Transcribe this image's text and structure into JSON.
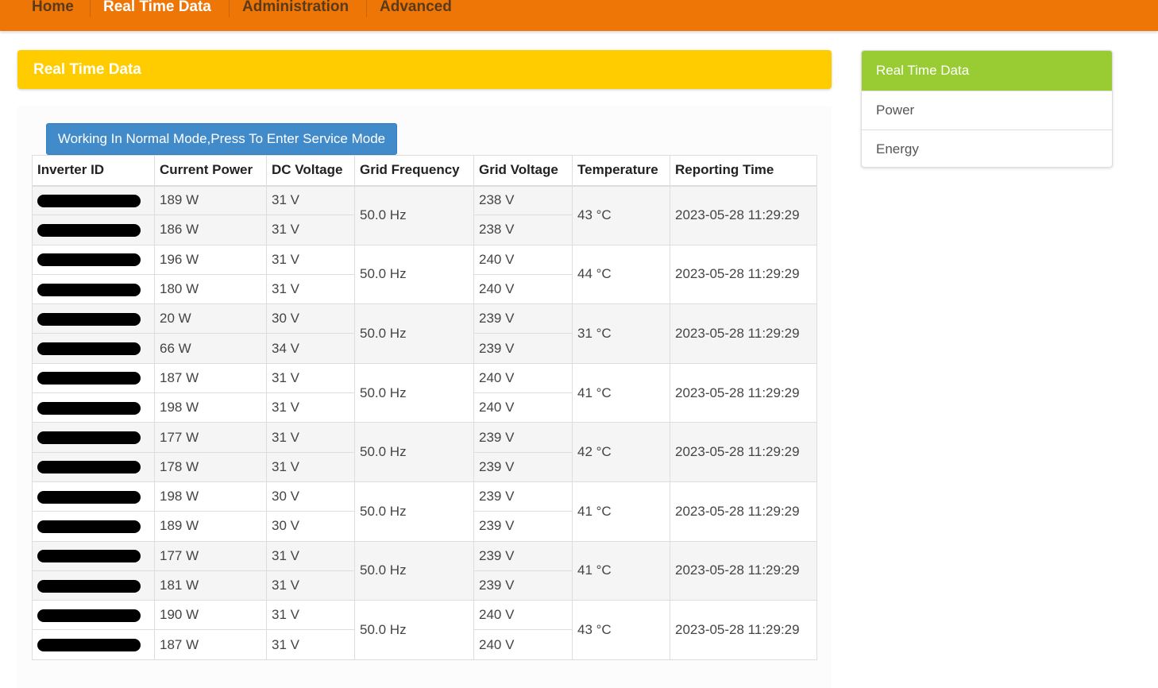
{
  "nav": {
    "items": [
      {
        "label": "Home",
        "active": false
      },
      {
        "label": "Real Time Data",
        "active": true
      },
      {
        "label": "Administration",
        "active": false
      },
      {
        "label": "Advanced",
        "active": false
      }
    ]
  },
  "page": {
    "title": "Real Time Data"
  },
  "mode_button": {
    "label": "Working In Normal Mode,Press To Enter Service Mode"
  },
  "table": {
    "headers": [
      "Inverter ID",
      "Current Power",
      "DC Voltage",
      "Grid Frequency",
      "Grid Voltage",
      "Temperature",
      "Reporting Time"
    ],
    "groups": [
      {
        "frequency": "50.0 Hz",
        "temperature": "43 °C",
        "time": "2023-05-28 11:29:29",
        "rows": [
          {
            "power": "189 W",
            "dc": "31 V",
            "grid": "238 V"
          },
          {
            "power": "186 W",
            "dc": "31 V",
            "grid": "238 V"
          }
        ]
      },
      {
        "frequency": "50.0 Hz",
        "temperature": "44 °C",
        "time": "2023-05-28 11:29:29",
        "rows": [
          {
            "power": "196 W",
            "dc": "31 V",
            "grid": "240 V"
          },
          {
            "power": "180 W",
            "dc": "31 V",
            "grid": "240 V"
          }
        ]
      },
      {
        "frequency": "50.0 Hz",
        "temperature": "31 °C",
        "time": "2023-05-28 11:29:29",
        "rows": [
          {
            "power": "20 W",
            "dc": "30 V",
            "grid": "239 V"
          },
          {
            "power": "66 W",
            "dc": "34 V",
            "grid": "239 V"
          }
        ]
      },
      {
        "frequency": "50.0 Hz",
        "temperature": "41 °C",
        "time": "2023-05-28 11:29:29",
        "rows": [
          {
            "power": "187 W",
            "dc": "31 V",
            "grid": "240 V"
          },
          {
            "power": "198 W",
            "dc": "31 V",
            "grid": "240 V"
          }
        ]
      },
      {
        "frequency": "50.0 Hz",
        "temperature": "42 °C",
        "time": "2023-05-28 11:29:29",
        "rows": [
          {
            "power": "177 W",
            "dc": "31 V",
            "grid": "239 V"
          },
          {
            "power": "178 W",
            "dc": "31 V",
            "grid": "239 V"
          }
        ]
      },
      {
        "frequency": "50.0 Hz",
        "temperature": "41 °C",
        "time": "2023-05-28 11:29:29",
        "rows": [
          {
            "power": "198 W",
            "dc": "30 V",
            "grid": "239 V"
          },
          {
            "power": "189 W",
            "dc": "30 V",
            "grid": "239 V"
          }
        ]
      },
      {
        "frequency": "50.0 Hz",
        "temperature": "41 °C",
        "time": "2023-05-28 11:29:29",
        "rows": [
          {
            "power": "177 W",
            "dc": "31 V",
            "grid": "239 V"
          },
          {
            "power": "181 W",
            "dc": "31 V",
            "grid": "239 V"
          }
        ]
      },
      {
        "frequency": "50.0 Hz",
        "temperature": "43 °C",
        "time": "2023-05-28 11:29:29",
        "rows": [
          {
            "power": "190 W",
            "dc": "31 V",
            "grid": "240 V"
          },
          {
            "power": "187 W",
            "dc": "31 V",
            "grid": "240 V"
          }
        ]
      }
    ]
  },
  "sidebar": {
    "header": "Real Time Data",
    "items": [
      {
        "label": "Power"
      },
      {
        "label": "Energy"
      }
    ]
  },
  "colors": {
    "navbar": "#ee7606",
    "title_bar": "#ffcc00",
    "button": "#428bca",
    "sidebar_header": "#99cc33"
  }
}
